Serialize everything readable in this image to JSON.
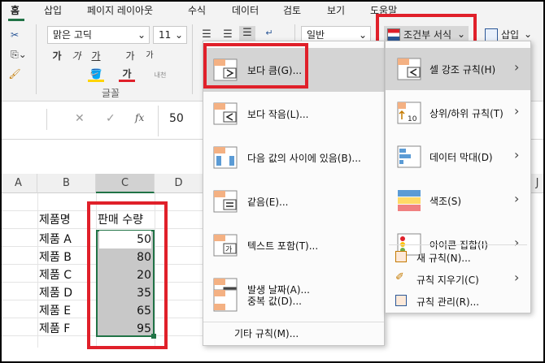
{
  "tabs": [
    "홈",
    "삽입",
    "페이지 레이아웃",
    "수식",
    "데이터",
    "검토",
    "보기",
    "도움말"
  ],
  "font": {
    "name": "맑은 고딕",
    "size": "11",
    "bold": "가",
    "italic": "가",
    "underline": "가",
    "grow": "가",
    "shrink": "가",
    "font_color_glyph": "가",
    "phonetic": "내천",
    "group_label": "글꼴"
  },
  "number_format": "일반",
  "conditional_format": {
    "label": "조건부 서식",
    "chevron": "⌄"
  },
  "insert_label": "삽입",
  "formula_bar": {
    "fx": "fx",
    "value": "50"
  },
  "columns": [
    "A",
    "B",
    "C",
    "D",
    "J"
  ],
  "sheet": {
    "header_b": "제품명",
    "header_c": "판매 수량",
    "rows": [
      {
        "name": "제품 A",
        "qty": "50"
      },
      {
        "name": "제품 B",
        "qty": "80"
      },
      {
        "name": "제품 C",
        "qty": "20"
      },
      {
        "name": "제품 D",
        "qty": "35"
      },
      {
        "name": "제품 E",
        "qty": "65"
      },
      {
        "name": "제품 F",
        "qty": "95"
      }
    ]
  },
  "menu_highlight": {
    "items": [
      "보다 큼(G)...",
      "보다 작음(L)...",
      "다음 값의 사이에 있음(B)...",
      "같음(E)...",
      "텍스트 포함(T)...",
      "발생 날짜(A)...",
      "중복 값(D)..."
    ],
    "footer": "기타 규칙(M)..."
  },
  "menu_main": {
    "items": [
      "셀 강조 규칙(H)",
      "상위/하위 규칙(T)",
      "데이터 막대(D)",
      "색조(S)",
      "아이콘 집합(I)"
    ],
    "small_items": [
      "새 규칙(N)...",
      "규칙 지우기(C)",
      "규칙 관리(R)..."
    ],
    "icon_labels": {
      "top10": "10"
    }
  },
  "icons": [
    "cut-icon",
    "copy-icon",
    "format-painter-icon",
    "fill-color-icon",
    "align-icon",
    "wrap-text-icon",
    "conditional-format-icon",
    "insert-cells-icon",
    "cancel-icon",
    "confirm-icon"
  ],
  "colors": {
    "highlight_red": "#e0202a",
    "selection_gray": "#c8c8c8",
    "excel_green": "#217346"
  }
}
